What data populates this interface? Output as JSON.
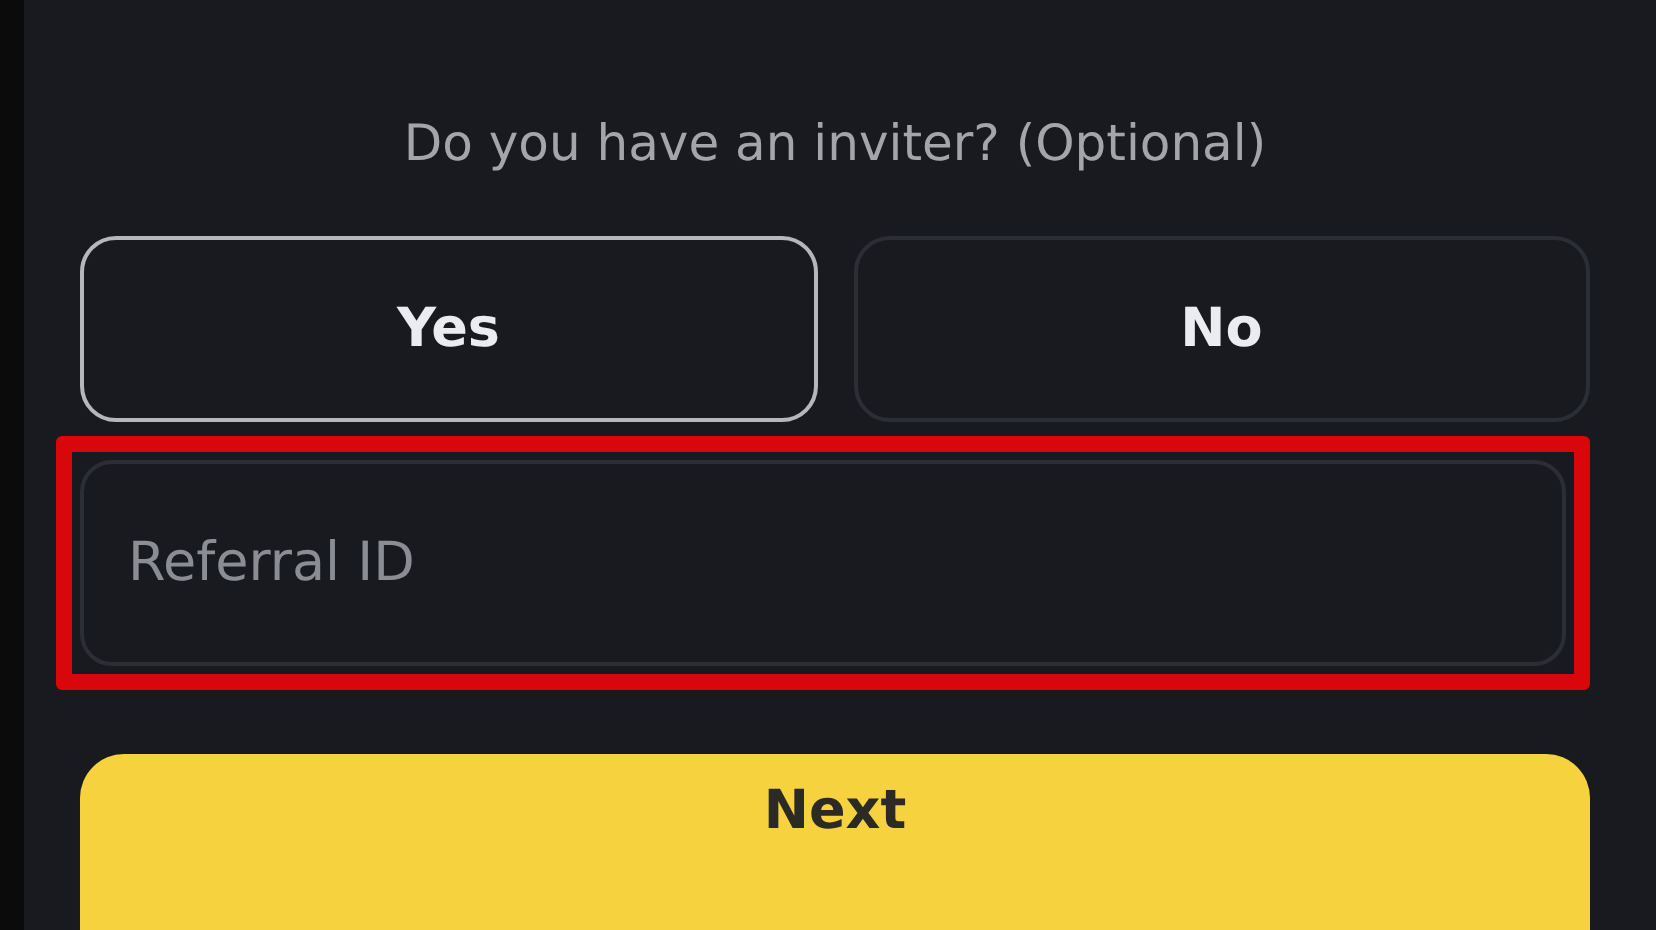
{
  "question": "Do you have an inviter? (Optional)",
  "choices": [
    {
      "label": "Yes",
      "selected": true
    },
    {
      "label": "No",
      "selected": false
    }
  ],
  "referral_field": {
    "placeholder": "Referral ID",
    "highlighted": true
  },
  "next_button": {
    "label": "Next"
  }
}
